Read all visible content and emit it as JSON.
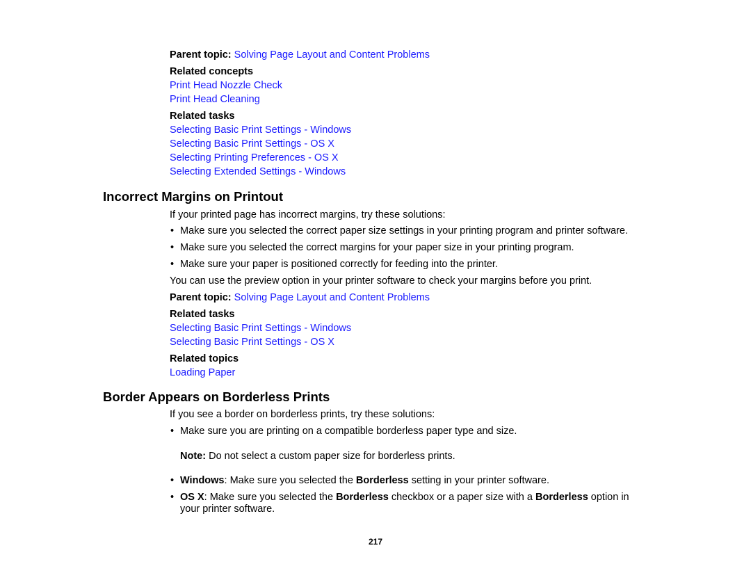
{
  "section1_related": {
    "parent_topic_label": "Parent topic:",
    "parent_topic_link": "Solving Page Layout and Content Problems",
    "related_concepts_heading": "Related concepts",
    "related_concepts": [
      "Print Head Nozzle Check",
      "Print Head Cleaning"
    ],
    "related_tasks_heading": "Related tasks",
    "related_tasks": [
      "Selecting Basic Print Settings - Windows",
      "Selecting Basic Print Settings - OS X",
      "Selecting Printing Preferences - OS X",
      "Selecting Extended Settings - Windows"
    ]
  },
  "incorrect_margins": {
    "title": "Incorrect Margins on Printout",
    "intro": "If your printed page has incorrect margins, try these solutions:",
    "bullets": [
      "Make sure you selected the correct paper size settings in your printing program and printer software.",
      "Make sure you selected the correct margins for your paper size in your printing program.",
      "Make sure your paper is positioned correctly for feeding into the printer."
    ],
    "bullet_glyph": "•",
    "outro": "You can use the preview option in your printer software to check your margins before you print.",
    "parent_topic_label": "Parent topic:",
    "parent_topic_link": "Solving Page Layout and Content Problems",
    "related_tasks_heading": "Related tasks",
    "related_tasks": [
      "Selecting Basic Print Settings - Windows",
      "Selecting Basic Print Settings - OS X"
    ],
    "related_topics_heading": "Related topics",
    "related_topics": [
      "Loading Paper"
    ]
  },
  "border_borderless": {
    "title": "Border Appears on Borderless Prints",
    "intro": "If you see a border on borderless prints, try these solutions:",
    "bullet1": "Make sure you are printing on a compatible borderless paper type and size.",
    "note_label": "Note:",
    "note_text": " Do not select a custom paper size for borderless prints.",
    "bullet2": {
      "lead": "Windows",
      "text1": ": Make sure you selected the ",
      "bold1": "Borderless",
      "text2": " setting in your printer software."
    },
    "bullet3": {
      "lead": "OS X",
      "text1": ": Make sure you selected the ",
      "bold1": "Borderless",
      "text2": " checkbox or a paper size with a ",
      "bold2": "Borderless",
      "text3": " option in",
      "line2": "your printer software."
    }
  },
  "page_number": "217",
  "colors": {
    "link": "#1a1aff",
    "text": "#000000",
    "background": "#ffffff"
  }
}
